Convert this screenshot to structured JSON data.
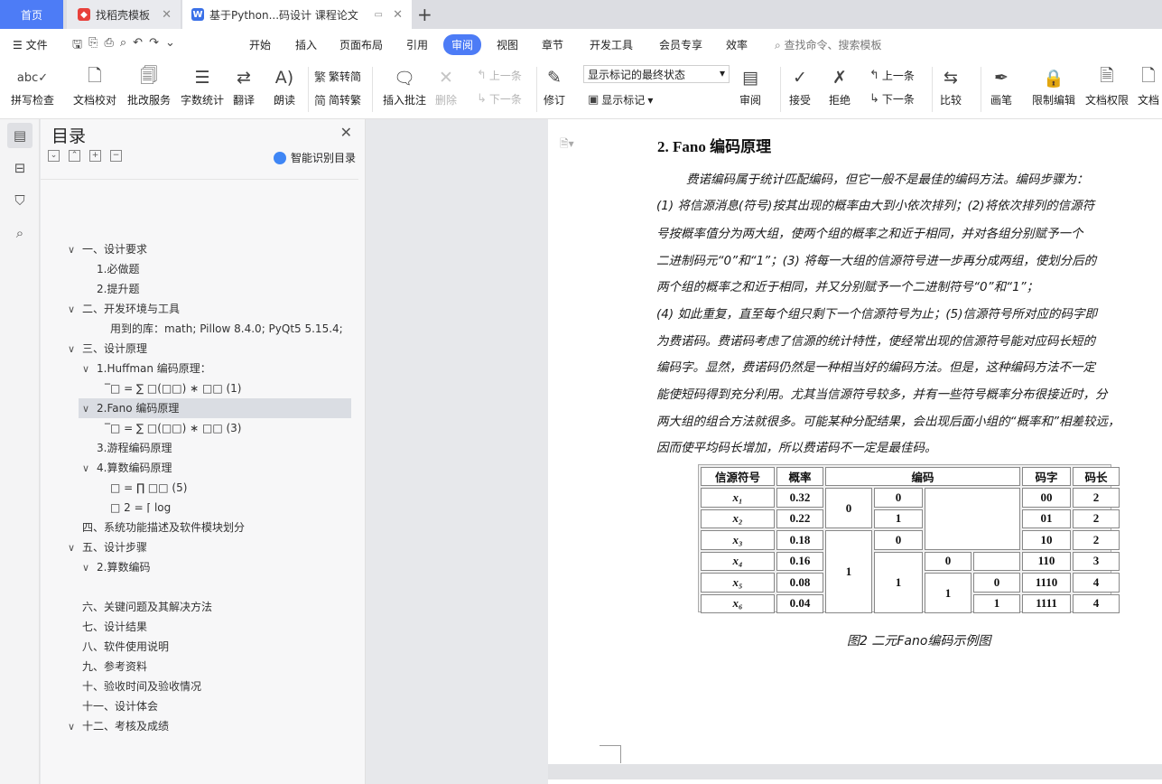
{
  "tabs": {
    "home": "首页",
    "template": "找稻壳模板",
    "doc": "基于Python...码设计 课程论文"
  },
  "menu": {
    "file": "文件",
    "items": [
      "开始",
      "插入",
      "页面布局",
      "引用",
      "审阅",
      "视图",
      "章节",
      "开发工具",
      "会员专享",
      "效率"
    ],
    "active": "审阅",
    "search": "查找命令、搜索模板"
  },
  "ribbon": {
    "spell": "拼写检查",
    "proof": "文档校对",
    "review_service": "批改服务",
    "word_count": "字数统计",
    "translate": "翻译",
    "read": "朗读",
    "trad": "繁转简",
    "simp": "简转繁",
    "insert_comment": "插入批注",
    "delete": "删除",
    "prev": "上一条",
    "next": "下一条",
    "revise": "修订",
    "markup_state": "显示标记的最终状态",
    "show_markup": "显示标记",
    "review": "审阅",
    "accept": "接受",
    "reject": "拒绝",
    "prev2": "上一条",
    "next2": "下一条",
    "compare": "比较",
    "pen": "画笔",
    "restrict": "限制编辑",
    "permission": "文档权限",
    "doc_more": "文档"
  },
  "toc": {
    "title": "目录",
    "smart": "智能识别目录",
    "items": [
      {
        "text": "一、设计要求",
        "chev": "∨"
      },
      {
        "text": "1.必做题",
        "chev": ""
      },
      {
        "text": "2.提升题",
        "chev": ""
      },
      {
        "text": "二、开发环境与工具",
        "chev": "∨"
      },
      {
        "text": "用到的库：math; Pillow 8.4.0; PyQt5 5.15.4;",
        "chev": ""
      },
      {
        "text": "三、设计原理",
        "chev": "∨"
      },
      {
        "text": "1.Huffman 编码原理：",
        "chev": "∨"
      },
      {
        "text": "̅□ =  ∑ □(□□) ∗   □□  (1)",
        "chev": ""
      },
      {
        "text": "2.Fano 编码原理",
        "chev": "∨"
      },
      {
        "text": "̅□ =  ∑ □(□□) ∗   □□  (3)",
        "chev": ""
      },
      {
        "text": "3.游程编码原理",
        "chev": ""
      },
      {
        "text": "4.算数编码原理",
        "chev": "∨"
      },
      {
        "text": "□ = ∏ □□   (5)",
        "chev": ""
      },
      {
        "text": "□        2 = ⌈ log",
        "chev": ""
      },
      {
        "text": "四、系统功能描述及软件模块划分",
        "chev": ""
      },
      {
        "text": "五、设计步骤",
        "chev": "∨"
      },
      {
        "text": "2.算数编码",
        "chev": "∨"
      },
      {
        "text": "六、关键问题及其解决方法",
        "chev": ""
      },
      {
        "text": "七、设计结果",
        "chev": ""
      },
      {
        "text": "八、软件使用说明",
        "chev": ""
      },
      {
        "text": "九、参考资料",
        "chev": ""
      },
      {
        "text": "十、验收时间及验收情况",
        "chev": ""
      },
      {
        "text": "十一、设计体会",
        "chev": ""
      },
      {
        "text": "十二、考核及成绩",
        "chev": "∨"
      }
    ]
  },
  "doc": {
    "heading": "2.   Fano 编码原理",
    "lines": [
      "费诺编码属于统计匹配编码，但它一般不是最佳的编码方法。编码步骤为：",
      "(1) 将信源消息(符号)按其出现的概率由大到小依次排列；(2)将依次排列的信源符",
      "号按概率值分为两大组，使两个组的概率之和近于相同，并对各组分别赋予一个",
      "二进制码元“0”和“1”；(3) 将每一大组的信源符号进一步再分成两组，使划分后的",
      "两个组的概率之和近于相同，并又分别赋予一个二进制符号“0”和“1”；",
      "(4) 如此重复，直至每个组只剩下一个信源符号为止；(5)信源符号所对应的码字即",
      "为费诺码。费诺码考虑了信源的统计特性，使经常出现的信源符号能对应码长短的",
      "编码字。显然，费诺码仍然是一种相当好的编码方法。但是，这种编码方法不一定",
      "能使短码得到充分利用。尤其当信源符号较多，并有一些符号概率分布很接近时，分",
      "两大组的组合方法就很多。可能某种分配结果，会出现后面小组的“概率和”相差较远，",
      "因而使平均码长增加，所以费诺码不一定是最佳码。"
    ],
    "caption": "图2 二元Fano编码示例图",
    "table": {
      "headers": [
        "信源符号",
        "概率",
        "编码",
        "码字",
        "码长"
      ],
      "symbols": [
        "x₁",
        "x₂",
        "x₃",
        "x₄",
        "x₅",
        "x₆"
      ],
      "probs": [
        "0.32",
        "0.22",
        "0.18",
        "0.16",
        "0.08",
        "0.04"
      ],
      "codewords": [
        "00",
        "01",
        "10",
        "110",
        "1110",
        "1111"
      ],
      "lengths": [
        "2",
        "2",
        "2",
        "3",
        "4",
        "4"
      ],
      "bits": {
        "c1_top": "0",
        "c1_bot": "1",
        "c2_r1": "0",
        "c2_r2": "1",
        "c2_r3": "0",
        "c2_r46": "1",
        "c3_r4": "0",
        "c3_r56": "1",
        "c4_r5": "0",
        "c4_r6": "1"
      }
    }
  }
}
